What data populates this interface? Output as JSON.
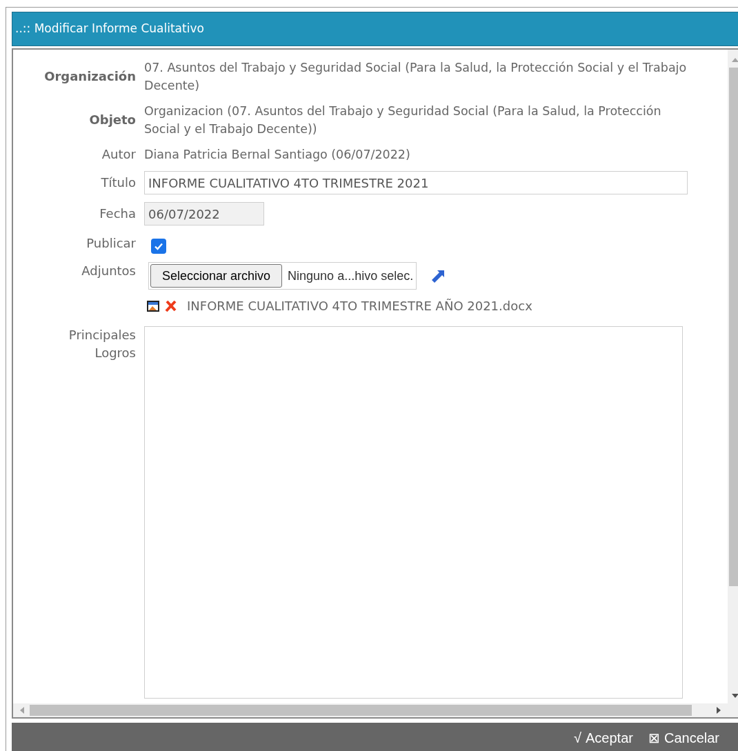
{
  "window": {
    "title": "..:: Modificar Informe Cualitativo"
  },
  "fields": [
    {
      "kind": "text",
      "label": "Organización",
      "bold": true,
      "value": "07. Asuntos del Trabajo y Seguridad Social (Para la Salud, la Protección Social y el Trabajo Decente)"
    },
    {
      "kind": "text",
      "label": "Objeto",
      "bold": true,
      "value": "Organizacion (07. Asuntos del Trabajo y Seguridad Social (Para la Salud, la Protección Social y el Trabajo Decente))"
    },
    {
      "kind": "text",
      "label": "Autor",
      "bold": false,
      "value": "Diana Patricia Bernal Santiago (06/07/2022)"
    },
    {
      "kind": "input",
      "label": "Título",
      "disabled": false,
      "value": "INFORME CUALITATIVO 4TO TRIMESTRE 2021"
    },
    {
      "kind": "input",
      "label": "Fecha",
      "disabled": true,
      "value": "06/07/2022"
    },
    {
      "kind": "checkbox",
      "label": "Publicar",
      "checked": true
    },
    {
      "kind": "file",
      "label": "Adjuntos",
      "button": "Seleccionar archivo",
      "status": "Ninguno a...hivo selec.",
      "attachments": [
        {
          "name": "INFORME CUALITATIVO 4TO TRIMESTRE AÑO 2021.docx"
        }
      ]
    },
    {
      "kind": "textarea",
      "label": "Principales Logros"
    }
  ],
  "footer": {
    "buttons": [
      {
        "icon": "√",
        "label": "Aceptar"
      },
      {
        "icon": "⊠",
        "label": "Cancelar"
      }
    ]
  }
}
